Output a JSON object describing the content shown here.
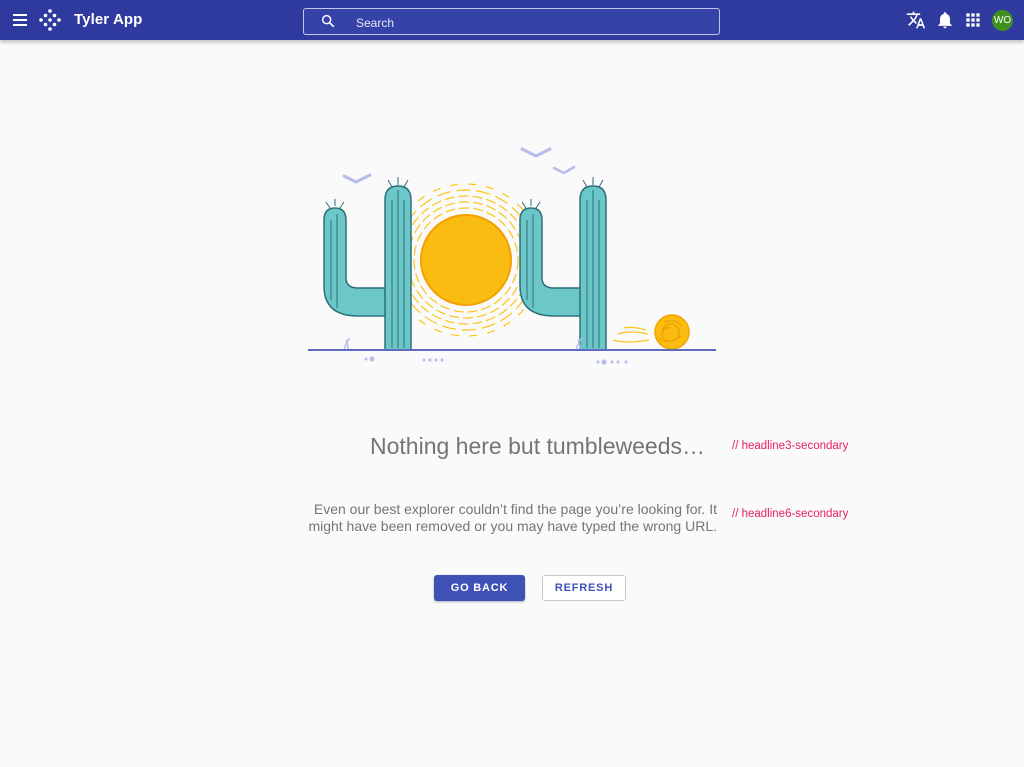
{
  "header": {
    "title": "Tyler App",
    "menu_icon": "menu-icon",
    "logo_icon": "tyler-logo-icon",
    "background_color": "#2f3a9e"
  },
  "search": {
    "placeholder": "Search",
    "value": "",
    "icon": "search-icon"
  },
  "toolbar": {
    "icons": [
      "translate-icon",
      "notifications-icon",
      "apps-grid-icon"
    ],
    "avatar_initials": "WO",
    "avatar_color": "#3f8f1f"
  },
  "error_page": {
    "illustration": "404-cactus-sun-tumbleweed",
    "headline": "Nothing here but tumbleweeds…",
    "headline_annotation": "// headline3-secondary",
    "message": "Even our best explorer couldn’t find the page you’re looking for. It might have been removed or you may have typed the wrong URL.",
    "message_annotation": "// headline6-secondary",
    "annotation_color": "#e91e63"
  },
  "actions": {
    "primary_label": "GO BACK",
    "secondary_label": "REFRESH",
    "accent_color": "#3f51b5"
  }
}
